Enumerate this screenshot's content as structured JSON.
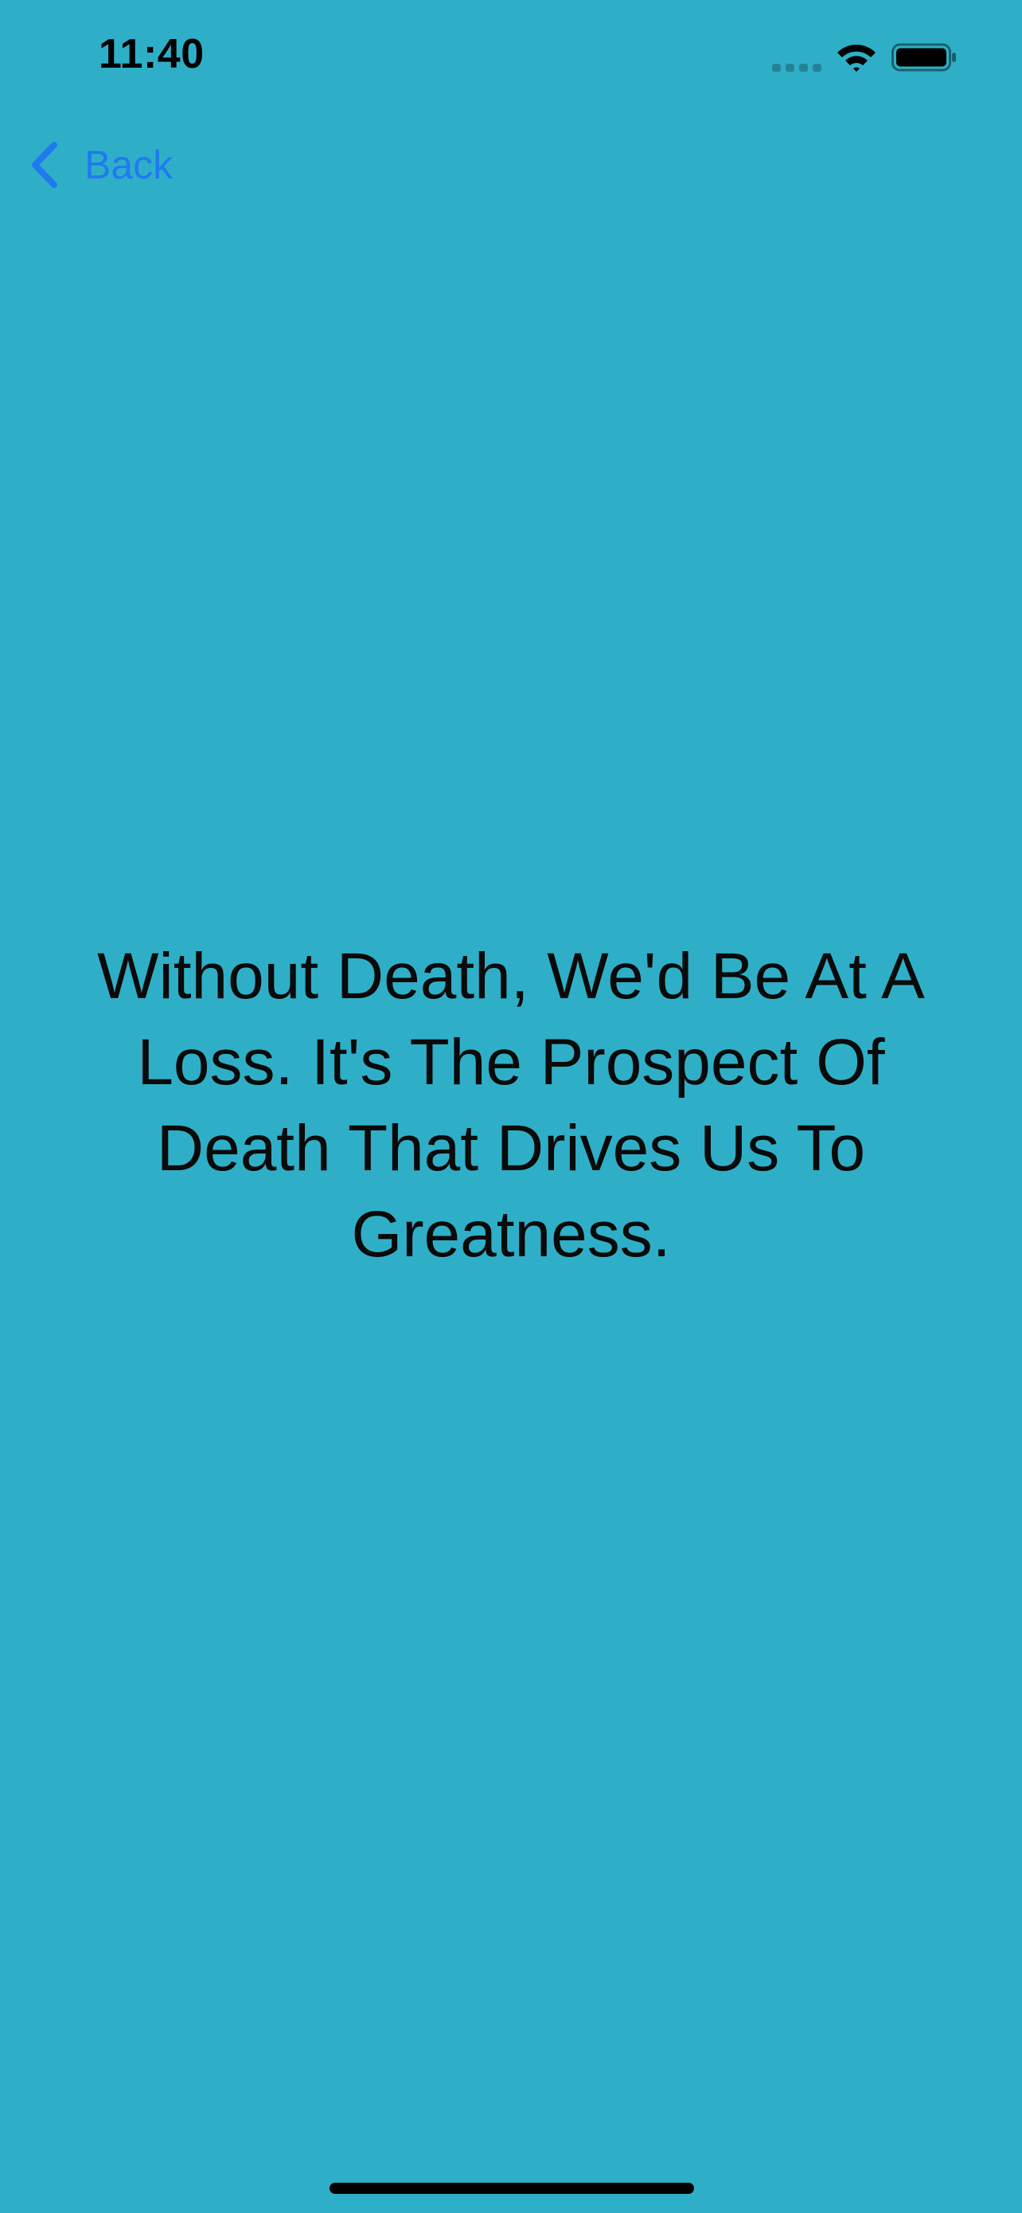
{
  "colors": {
    "background": "#2FAFC7",
    "accent": "#1F7AF2",
    "text": "#0A0A0A"
  },
  "status_bar": {
    "time": "11:40",
    "signal_icon": "cellular-signal-icon",
    "wifi_icon": "wifi-icon",
    "battery_icon": "battery-icon"
  },
  "nav": {
    "back_label": "Back",
    "back_icon": "chevron-left-icon"
  },
  "quote": {
    "text": "Without Death, We'd Be At A Loss. It's The Prospect Of Death That Drives Us To Greatness."
  }
}
